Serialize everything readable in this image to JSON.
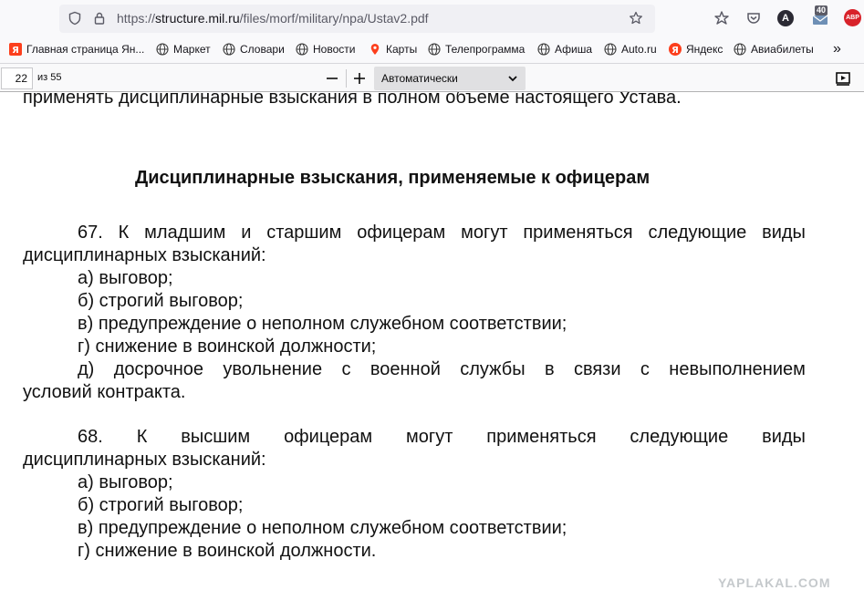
{
  "browser": {
    "url_prefix": "https://",
    "url_host": "structure.mil.ru",
    "url_path": "/files/morf/military/npa/Ustav2.pdf",
    "notification_count": "40",
    "account_letter": "A",
    "addon_label": "ABP"
  },
  "bookmarks": [
    {
      "label": "Главная страница Ян...",
      "icon": "yandex-icon"
    },
    {
      "label": "Маркет",
      "icon": "globe-icon"
    },
    {
      "label": "Словари",
      "icon": "globe-icon"
    },
    {
      "label": "Новости",
      "icon": "globe-icon"
    },
    {
      "label": "Карты",
      "icon": "map-pin-icon"
    },
    {
      "label": "Телепрограмма",
      "icon": "globe-icon"
    },
    {
      "label": "Афиша",
      "icon": "globe-icon"
    },
    {
      "label": "Auto.ru",
      "icon": "globe-icon"
    },
    {
      "label": "Яндекс",
      "icon": "yandex-icon"
    },
    {
      "label": "Авиабилеты",
      "icon": "globe-icon"
    }
  ],
  "pdf_toolbar": {
    "page_number": "22",
    "page_total": "из 55",
    "zoom_out": "−",
    "zoom_in": "+",
    "scale": "Автоматически"
  },
  "document": {
    "top_line": "применять дисциплинарные взыскания в полном объеме настоящего Устава.",
    "heading": "Дисциплинарные взыскания, применяемые к офицерам",
    "p67_line1": [
      "67.",
      "К",
      "младшим",
      "и",
      "старшим",
      "офицерам",
      "могут",
      "применяться",
      "следующие",
      "виды"
    ],
    "p67_line2": "дисциплинарных взысканий:",
    "p67_items": [
      "а) выговор;",
      "б) строгий выговор;",
      "в) предупреждение о неполном служебном соответствии;",
      "г) снижение в воинской должности;"
    ],
    "p67_item_d": [
      "д)",
      "досрочное",
      "увольнение",
      "с",
      "военной",
      "службы",
      "в",
      "связи",
      "с",
      "невыполнением"
    ],
    "p67_item_d_cont": "условий контракта.",
    "p68_line1": [
      "68.",
      "К",
      "высшим",
      "офицерам",
      "могут",
      "применяться",
      "следующие",
      "виды"
    ],
    "p68_line2": "дисциплинарных взысканий:",
    "p68_items": [
      "а) выговор;",
      "б) строгий выговор;",
      "в) предупреждение о неполном служебном соответствии;",
      "г) снижение в воинской должности."
    ]
  },
  "watermark": "YAPLAKAL.COM",
  "colors": {
    "toolbar_bg": "#f9f9fb",
    "urlbar_bg": "#f0f0f4",
    "yandex_red": "#fc3f1d",
    "abp_red": "#d8222a"
  }
}
